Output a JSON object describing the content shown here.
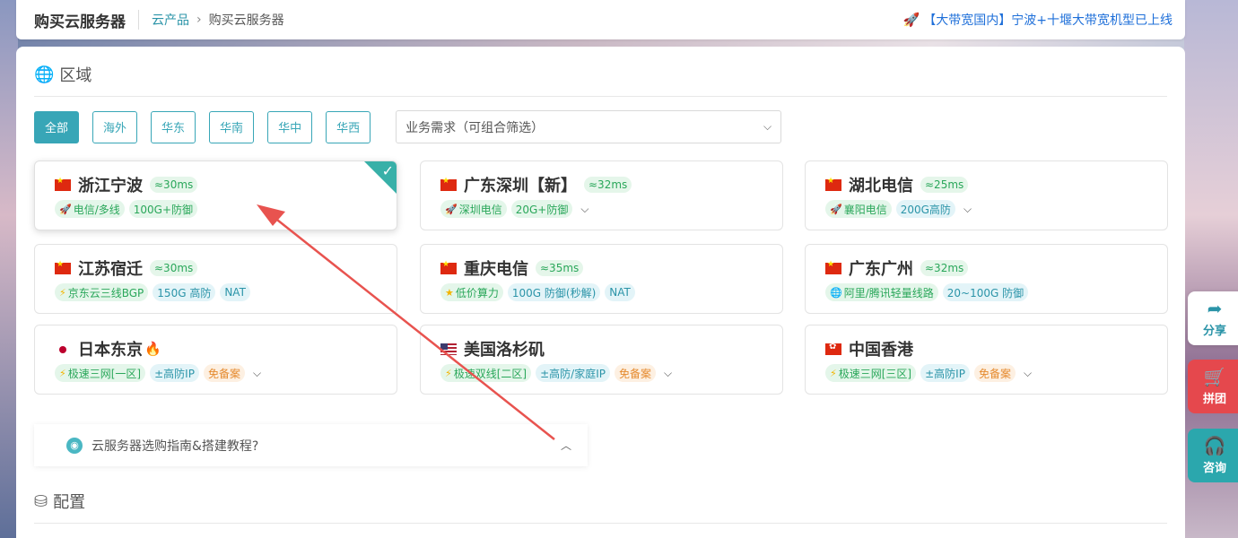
{
  "header": {
    "title": "购买云服务器",
    "breadcrumb": [
      "云产品",
      "购买云服务器"
    ],
    "breadcrumb_sep": "›",
    "notice": "【大带宽国内】宁波+十堰大带宽机型已上线"
  },
  "region": {
    "title": "区域",
    "filters": [
      "全部",
      "海外",
      "华东",
      "华南",
      "华中",
      "华西"
    ],
    "active_filter": "全部",
    "select_placeholder": "业务需求（可组合筛选）"
  },
  "cards": [
    {
      "flag": "cn",
      "name": "浙江宁波",
      "latency": "≈30ms",
      "selected": true,
      "tags": [
        {
          "text": "电信/多线",
          "style": "green",
          "icon": "rocket-icon"
        },
        {
          "text": "100G+防御",
          "style": "green"
        }
      ],
      "expand": false
    },
    {
      "flag": "cn",
      "name": "广东深圳【新】",
      "latency": "≈32ms",
      "tags": [
        {
          "text": "深圳电信",
          "style": "green",
          "icon": "rocket-icon"
        },
        {
          "text": "20G+防御",
          "style": "green"
        }
      ],
      "expand": true
    },
    {
      "flag": "cn",
      "name": "湖北电信",
      "latency": "≈25ms",
      "tags": [
        {
          "text": "襄阳电信",
          "style": "green",
          "icon": "rocket-icon"
        },
        {
          "text": "200G高防",
          "style": "cyan"
        }
      ],
      "expand": true
    },
    {
      "flag": "cn",
      "name": "江苏宿迁",
      "latency": "≈30ms",
      "tags": [
        {
          "text": "京东云三线BGP",
          "style": "green",
          "icon": "bolt-icon"
        },
        {
          "text": "150G 高防",
          "style": "cyan"
        },
        {
          "text": "NAT",
          "style": "cyan"
        }
      ],
      "expand": false
    },
    {
      "flag": "cn",
      "name": "重庆电信",
      "latency": "≈35ms",
      "tags": [
        {
          "text": "低价算力",
          "style": "green",
          "icon": "star-icon"
        },
        {
          "text": "100G 防御(秒解)",
          "style": "cyan"
        },
        {
          "text": "NAT",
          "style": "cyan"
        }
      ],
      "expand": false
    },
    {
      "flag": "cn",
      "name": "广东广州",
      "latency": "≈32ms",
      "tags": [
        {
          "text": "阿里/腾讯轻量线路",
          "style": "green",
          "icon": "globe-icon"
        },
        {
          "text": "20~100G 防御",
          "style": "cyan"
        }
      ],
      "expand": false
    },
    {
      "flag": "jp",
      "name": "日本东京",
      "fire": true,
      "tags": [
        {
          "text": "极速三网[一区]",
          "style": "green",
          "icon": "bolt-icon"
        },
        {
          "text": "±高防IP",
          "style": "cyan"
        },
        {
          "text": "免备案",
          "style": "orange"
        }
      ],
      "expand": true
    },
    {
      "flag": "us",
      "name": "美国洛杉矶",
      "tags": [
        {
          "text": "极速双线[二区]",
          "style": "green",
          "icon": "bolt-icon"
        },
        {
          "text": "±高防/家庭IP",
          "style": "cyan"
        },
        {
          "text": "免备案",
          "style": "orange"
        }
      ],
      "expand": true
    },
    {
      "flag": "hk",
      "name": "中国香港",
      "tags": [
        {
          "text": "极速三网[三区]",
          "style": "green",
          "icon": "bolt-icon"
        },
        {
          "text": "±高防IP",
          "style": "cyan"
        },
        {
          "text": "免备案",
          "style": "orange"
        }
      ],
      "expand": true
    }
  ],
  "guide": {
    "text": "云服务器选购指南&搭建教程?"
  },
  "config": {
    "title": "配置"
  },
  "side": {
    "share": "分享",
    "group": "拼团",
    "consult": "咨询"
  },
  "colors": {
    "accent": "#38a6b7",
    "green": "#2aa75a",
    "orange": "#e58a2e",
    "arrow": "#e8534f"
  }
}
